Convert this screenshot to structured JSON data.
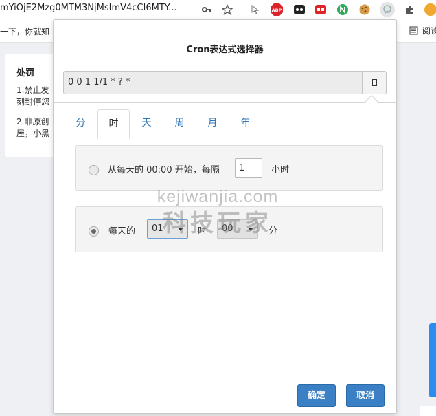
{
  "browser": {
    "url": "mYiOjE2Mzg0MTM3NjMsImV4cCI6MTY...",
    "bookmark_left": "一下，你就知",
    "bookmark_right": "阅读"
  },
  "background": {
    "title": "处罚",
    "lines": [
      "1.禁止发",
      "刻封停您",
      "2.非原创",
      "屋，小黑"
    ]
  },
  "dialog": {
    "title": "Cron表达式选择器",
    "expression": "0 0 1 1/1 * ? *",
    "tabs": [
      "分",
      "时",
      "天",
      "周",
      "月",
      "年"
    ],
    "active_tab": "时",
    "option1": {
      "prefix": "从每天的 00:00 开始，每隔",
      "interval": "1",
      "unit": "小时"
    },
    "option2": {
      "prefix": "每天的",
      "hour_value": "01",
      "hour_label": "时",
      "minute_value": "00",
      "minute_label": "分"
    },
    "selected_option": 2,
    "confirm_label": "确定",
    "cancel_label": "取消"
  },
  "watermark": {
    "line1": "kejiwanjia.com",
    "line2": "科技玩家"
  },
  "icons": {
    "ext_abp": "ABP"
  },
  "colors": {
    "accent": "#3b7fc4",
    "tab_link": "#2f77b8",
    "side_tab": "#2d8cf0"
  }
}
